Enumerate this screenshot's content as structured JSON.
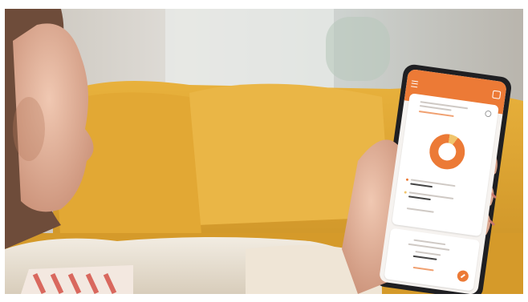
{
  "scene": {
    "description_colors": {
      "sofa": "#e6ad35",
      "wall": "#d7d4ce",
      "sweater": "#efe6d8",
      "skin": "#e8b9a0",
      "hair": "#7a5642",
      "phone_frame": "#1f1f22",
      "app_accent": "#ec7a36"
    }
  },
  "phone": {
    "icons": [
      "menu-icon",
      "bell-icon",
      "settings-icon",
      "fab-icon"
    ]
  }
}
